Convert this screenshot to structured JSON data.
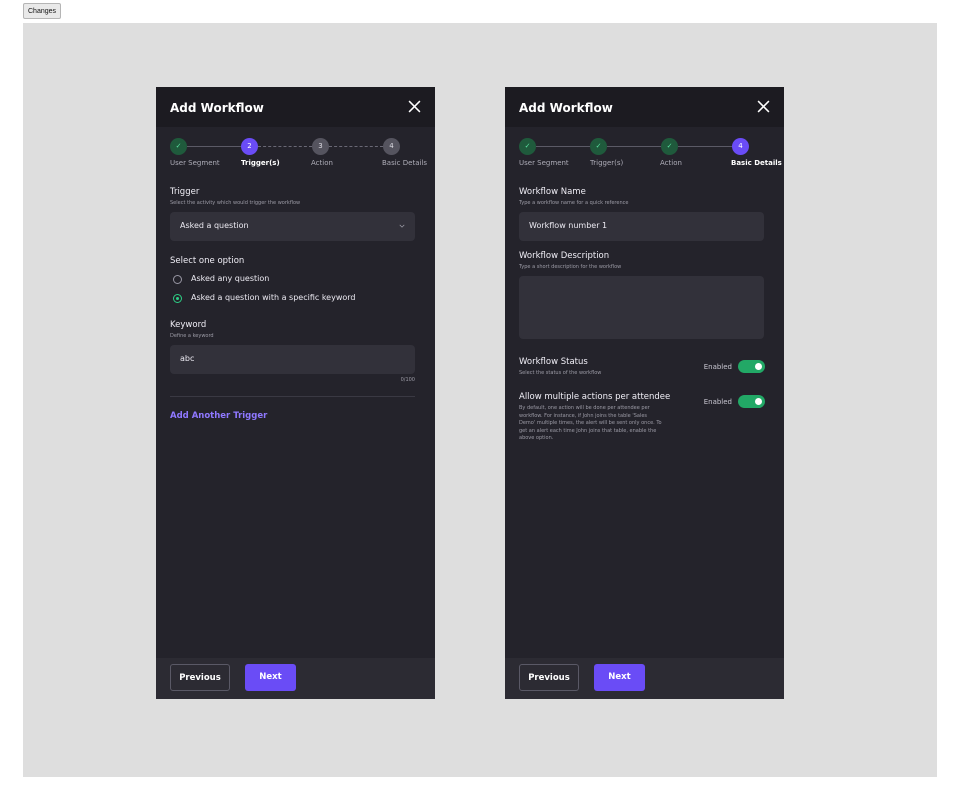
{
  "toolbar": {
    "changes_label": "Changes"
  },
  "panel_left": {
    "title": "Add Workflow",
    "steps": [
      {
        "label": "User Segment",
        "state": "done",
        "marker": "✓"
      },
      {
        "label": "Trigger(s)",
        "state": "active",
        "marker": "2"
      },
      {
        "label": "Action",
        "state": "todo",
        "marker": "3"
      },
      {
        "label": "Basic Details",
        "state": "todo",
        "marker": "4"
      }
    ],
    "trigger": {
      "title": "Trigger",
      "subtitle": "Select the activity which would trigger the workflow",
      "selected_value": "Asked a question"
    },
    "option": {
      "title": "Select one option",
      "choices": [
        {
          "label": "Asked any question",
          "selected": false
        },
        {
          "label": "Asked a question with a specific keyword",
          "selected": true
        }
      ]
    },
    "keyword": {
      "title": "Keyword",
      "subtitle": "Define a keyword",
      "value": "abc",
      "counter": "0/100"
    },
    "add_trigger_label": "Add Another Trigger",
    "footer": {
      "previous_label": "Previous",
      "next_label": "Next"
    }
  },
  "panel_right": {
    "title": "Add Workflow",
    "steps": [
      {
        "label": "User Segment",
        "state": "done",
        "marker": "✓"
      },
      {
        "label": "Trigger(s)",
        "state": "done",
        "marker": "✓"
      },
      {
        "label": "Action",
        "state": "done",
        "marker": "✓"
      },
      {
        "label": "Basic Details",
        "state": "active",
        "marker": "4"
      }
    ],
    "name": {
      "title": "Workflow Name",
      "subtitle": "Type a workflow name for a quick reference",
      "value": "Workflow number 1"
    },
    "description": {
      "title": "Workflow Description",
      "subtitle": "Type a short description for the workflow",
      "value": ""
    },
    "status": {
      "title": "Workflow Status",
      "subtitle": "Select the status of the workflow",
      "toggle_label": "Enabled",
      "enabled": true
    },
    "multiple": {
      "title": "Allow multiple actions per attendee",
      "description": "By default, one action will be done per attendee per workflow. For instance, if John joins the table 'Sales Demo' multiple times, the alert will be sent only once. To get an alert each time John joins that table, enable the above option.",
      "toggle_label": "Enabled",
      "enabled": true
    },
    "footer": {
      "previous_label": "Previous",
      "next_label": "Next"
    }
  },
  "colors": {
    "panel_bg": "#24232b",
    "accent": "#6a4cf6",
    "success": "#22a866",
    "stage_bg": "#dedede"
  }
}
